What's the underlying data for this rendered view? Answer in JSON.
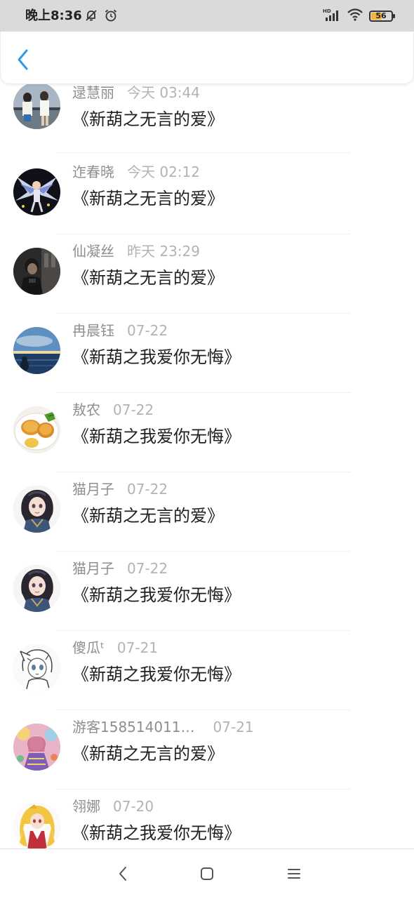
{
  "status_bar": {
    "time": "晚上8:36",
    "battery_level": "56",
    "battery_fraction": 0.56,
    "signal_badge": "HD",
    "icons": [
      "mute-bell-icon",
      "alarm-clock-icon",
      "signal-icon",
      "wifi-icon",
      "battery-icon"
    ]
  },
  "header": {
    "back_icon": "chevron-left-icon",
    "accent_color": "#2b9be8"
  },
  "list": {
    "items": [
      {
        "user": "逯慧丽",
        "time": "今天 03:44",
        "title": "《新葫之无言的爱》",
        "avatar": "two-girls-photo"
      },
      {
        "user": "迮春晓",
        "time": "今天 02:12",
        "title": "《新葫之无言的爱》",
        "avatar": "anime-winged-character"
      },
      {
        "user": "仙凝丝",
        "time": "昨天 23:29",
        "title": "《新葫之无言的爱》",
        "avatar": "dark-portrait-photo"
      },
      {
        "user": "冉晨钰",
        "time": "07-22",
        "title": "《新葫之我爱你无悔》",
        "avatar": "sea-sunset-photo"
      },
      {
        "user": "敖农",
        "time": "07-22",
        "title": "《新葫之我爱你无悔》",
        "avatar": "fried-food-photo"
      },
      {
        "user": "猫月子",
        "time": "07-22",
        "title": "《新葫之无言的爱》",
        "avatar": "anime-girl-dark-hair"
      },
      {
        "user": "猫月子",
        "time": "07-22",
        "title": "《新葫之我爱你无悔》",
        "avatar": "anime-girl-dark-hair"
      },
      {
        "user": "傻瓜ᵗ",
        "time": "07-21",
        "title": "《新葫之我爱你无悔》",
        "avatar": "anime-sketch-girl"
      },
      {
        "user": "游客158514011…",
        "time": "07-21",
        "title": "《新葫之无言的爱》",
        "avatar": "colorful-anime-art"
      },
      {
        "user": "翎娜",
        "time": "07-20",
        "title": "《新葫之我爱你无悔》",
        "avatar": "anime-blonde-girl"
      }
    ]
  },
  "nav_bar": {
    "icons": [
      "nav-back-icon",
      "nav-home-icon",
      "nav-menu-icon"
    ]
  }
}
